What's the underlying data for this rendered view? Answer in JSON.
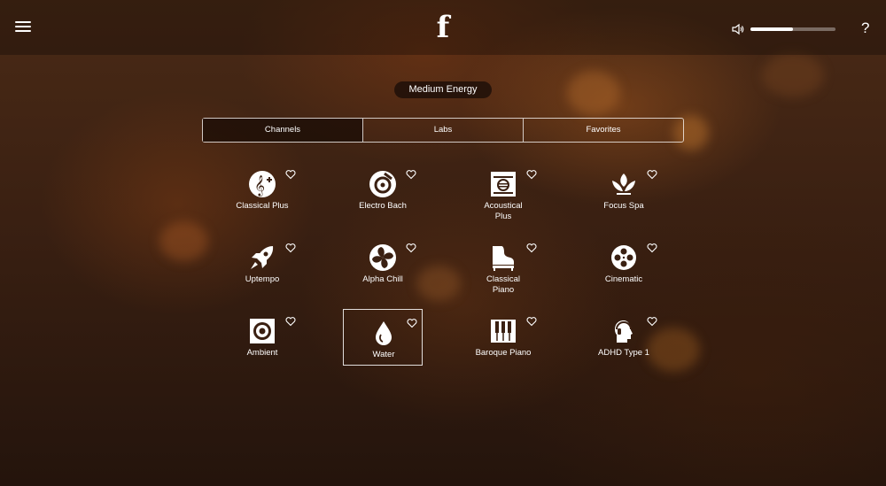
{
  "header": {
    "logo_letter": "f",
    "help_label": "?",
    "volume_level": 0.5
  },
  "energy": {
    "label": "Medium Energy"
  },
  "tabs": [
    {
      "label": "Channels",
      "active": true
    },
    {
      "label": "Labs",
      "active": false
    },
    {
      "label": "Favorites",
      "active": false
    }
  ],
  "channels": [
    {
      "label": "Classical Plus",
      "icon": "treble-clef-plus-icon"
    },
    {
      "label": "Electro Bach",
      "icon": "electro-bach-icon"
    },
    {
      "label": "Acoustical\nPlus",
      "icon": "acoustical-plus-icon"
    },
    {
      "label": "Focus Spa",
      "icon": "lotus-icon"
    },
    {
      "label": "Uptempo",
      "icon": "rocket-icon"
    },
    {
      "label": "Alpha Chill",
      "icon": "fan-icon"
    },
    {
      "label": "Classical\nPiano",
      "icon": "grand-piano-icon"
    },
    {
      "label": "Cinematic",
      "icon": "film-reel-icon"
    },
    {
      "label": "Ambient",
      "icon": "speaker-icon"
    },
    {
      "label": "Water",
      "icon": "water-drop-icon",
      "selected": true
    },
    {
      "label": "Baroque Piano",
      "icon": "piano-keys-icon"
    },
    {
      "label": "ADHD Type 1",
      "icon": "head-headphones-icon"
    }
  ]
}
